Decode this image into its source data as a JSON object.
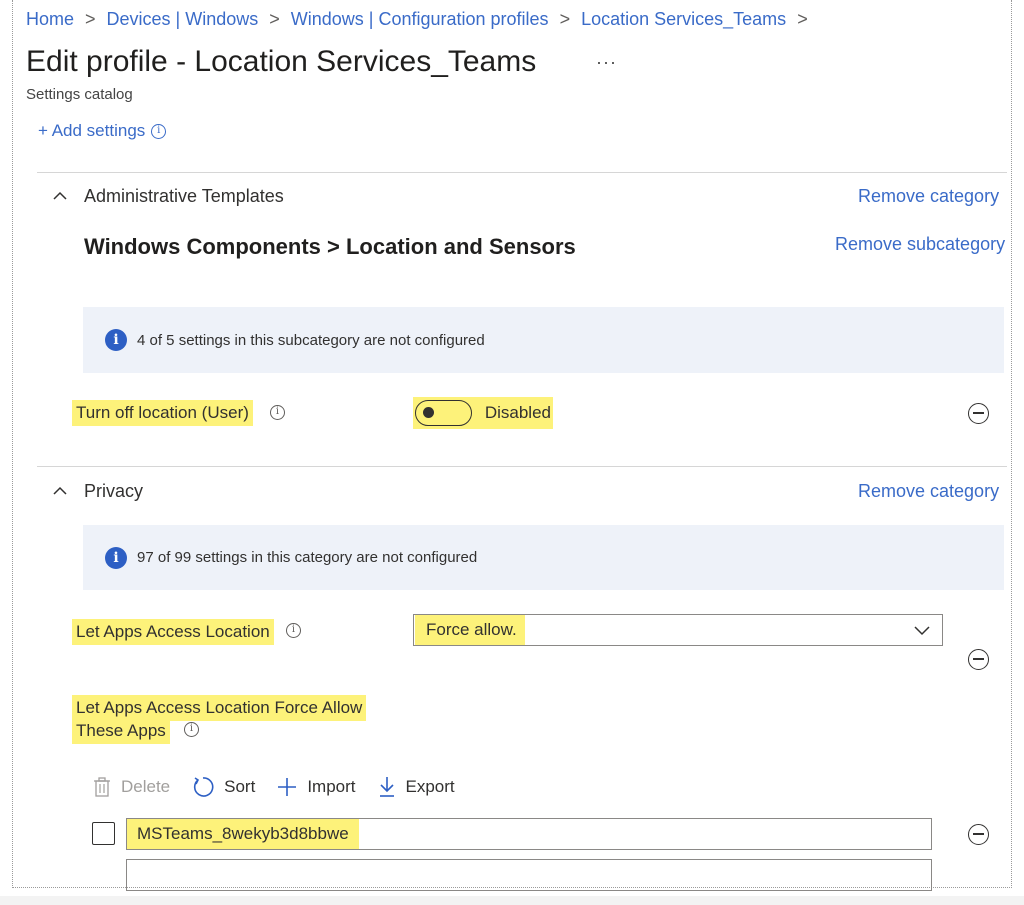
{
  "breadcrumb": {
    "items": [
      "Home",
      "Devices | Windows",
      "Windows | Configuration profiles",
      "Location Services_Teams"
    ],
    "separator": ">"
  },
  "header": {
    "title": "Edit profile - Location Services_Teams",
    "more": "···",
    "subtitle": "Settings catalog"
  },
  "add_settings": {
    "label": "+ Add settings"
  },
  "categories": [
    {
      "label": "Administrative Templates",
      "remove_label": "Remove category",
      "subcategory": {
        "title": "Windows Components > Location and Sensors",
        "remove_label": "Remove subcategory",
        "info": "4 of 5 settings in this subcategory are not configured"
      },
      "setting": {
        "label": "Turn off location (User)",
        "toggle_state": "Disabled"
      }
    },
    {
      "label": "Privacy",
      "remove_label": "Remove category",
      "info": "97 of 99 settings in this category are not configured",
      "setting": {
        "label": "Let Apps Access Location",
        "dropdown_value": "Force allow."
      },
      "list_setting": {
        "label_line1": "Let Apps Access Location Force Allow",
        "label_line2": "These Apps",
        "toolbar": {
          "delete": "Delete",
          "sort": "Sort",
          "import": "Import",
          "export": "Export"
        },
        "rows": [
          {
            "value": "MSTeams_8wekyb3d8bbwe"
          }
        ]
      }
    }
  ],
  "colors": {
    "link": "#3a6bc8",
    "highlight": "#fdf27a",
    "info_bg": "#eef2f9",
    "info_icon": "#2d5fc4"
  }
}
